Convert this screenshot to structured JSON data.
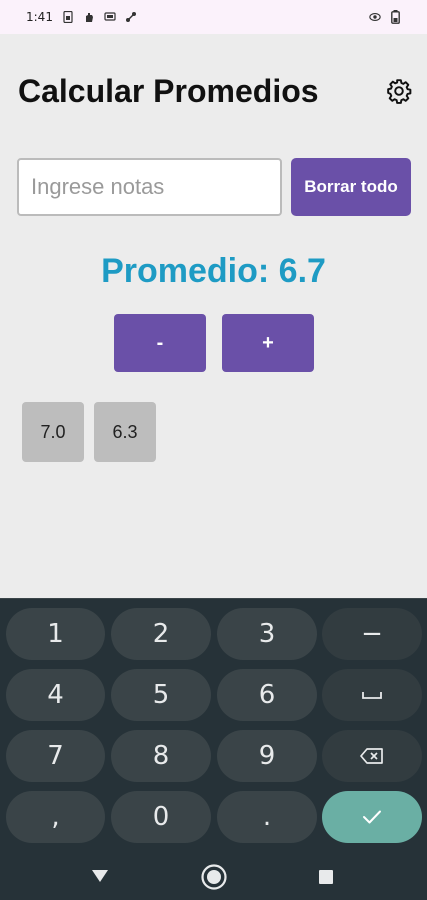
{
  "status_bar": {
    "time": "1:41",
    "left_icons": [
      "sim-card-icon",
      "hand-icon",
      "screen-cast-icon",
      "signal-icon"
    ],
    "right_icons": [
      "eye-icon",
      "battery-icon"
    ]
  },
  "header": {
    "title": "Calcular Promedios",
    "settings_icon": "gear-icon"
  },
  "input": {
    "placeholder": "Ingrese notas",
    "value": ""
  },
  "clear_button": {
    "label": "Borrar todo"
  },
  "average": {
    "label": "Promedio: ",
    "value": "6.7"
  },
  "controls": {
    "minus_label": "-",
    "plus_label": "+"
  },
  "notes": [
    "7.0",
    "6.3"
  ],
  "keyboard": {
    "rows": [
      [
        "1",
        "2",
        "3",
        "−"
      ],
      [
        "4",
        "5",
        "6",
        "space"
      ],
      [
        "7",
        "8",
        "9",
        "backspace"
      ],
      [
        ",",
        "0",
        ".",
        "enter"
      ]
    ],
    "accent_color": "#6aafa4"
  },
  "nav_bar": {
    "icons": [
      "back-icon",
      "home-icon",
      "recents-icon"
    ]
  },
  "colors": {
    "primary": "#6a50a8",
    "average_text": "#1e9bc4",
    "background": "#ececec",
    "keyboard_bg": "#263238"
  }
}
